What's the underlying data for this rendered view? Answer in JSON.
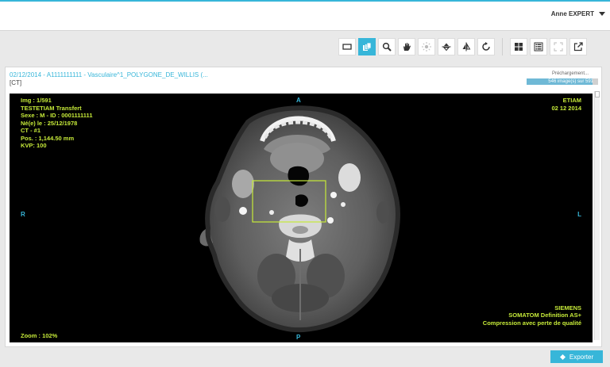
{
  "header": {
    "user_name": "Anne EXPERT",
    "user_menu_icon": "caret-down-icon"
  },
  "toolbar": {
    "tools": [
      {
        "icon": "rectangle-roi-icon"
      },
      {
        "icon": "layers-icon",
        "active": true
      },
      {
        "icon": "magnifier-icon"
      },
      {
        "icon": "hand-pan-icon"
      },
      {
        "icon": "brightness-icon"
      },
      {
        "icon": "flip-vertical-icon"
      },
      {
        "icon": "flip-horizontal-icon"
      },
      {
        "icon": "reset-rotate-icon"
      },
      {
        "icon": "grid-layout-icon"
      },
      {
        "icon": "series-layout-icon"
      },
      {
        "icon": "fullscreen-icon"
      },
      {
        "icon": "popout-icon"
      }
    ]
  },
  "study": {
    "title": "02/12/2014 - A1111111111 - Vasculaire^1_POLYGONE_DE_WILLIS (...",
    "modality": "[CT]"
  },
  "preload": {
    "label": "Préchargement...",
    "progress_text": "546 image(s) sur 591",
    "loaded": 546,
    "total": 591
  },
  "viewer": {
    "top_left": [
      "Img : 1/591",
      "TESTETIAM Transfert",
      "Sexe : M - ID : 0001111111",
      "Né(e) le : 25/12/1978",
      "CT - #1",
      "Pos. : 1,144.50 mm",
      "KVP: 100"
    ],
    "top_right": [
      "ETIAM",
      "02 12 2014"
    ],
    "bottom_right": [
      "SIEMENS",
      "SOMATOM Definition AS+",
      "Compression avec perte de qualité"
    ],
    "bottom_left": "Zoom : 102%",
    "orientation": {
      "top": "A",
      "bottom": "P",
      "left": "R",
      "right": "L"
    },
    "roi_color": "#c6ea39"
  },
  "export": {
    "label": "Exporter",
    "icon": "export-icon"
  },
  "colors": {
    "accent": "#37b6d9",
    "overlay_text": "#c6ea39"
  }
}
